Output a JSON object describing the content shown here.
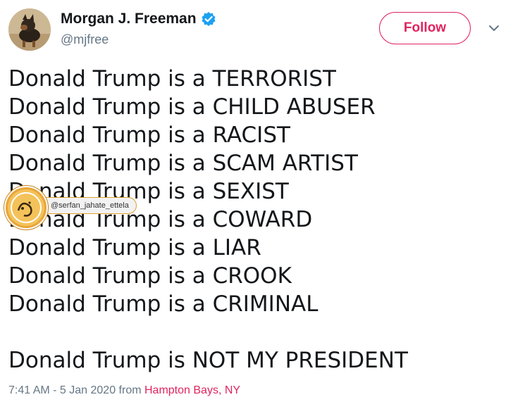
{
  "user": {
    "display_name": "Morgan J. Freeman",
    "handle": "@mjfree",
    "verified": true,
    "avatar": "dog-photo-avatar"
  },
  "follow_button": {
    "label": "Follow"
  },
  "menu": {
    "icon": "chevron-down-icon"
  },
  "tweet": {
    "lines": [
      "Donald Trump is a TERRORIST",
      "Donald Trump is a CHILD ABUSER",
      "Donald Trump is a RACIST",
      "Donald Trump is a SCAM ARTIST",
      "Donald Trump is a SEXIST",
      "Donald Trump is a COWARD",
      "Donald Trump is a LIAR",
      "Donald Trump is a CROOK",
      "Donald Trump is a CRIMINAL",
      "",
      "Donald Trump is NOT MY PRESIDENT"
    ]
  },
  "meta": {
    "time": "7:41 AM",
    "separator": " - ",
    "date": "5 Jan 2020",
    "from_label": " from ",
    "location": "Hampton Bays, NY"
  },
  "watermark": {
    "tag": "@serfan_jahate_ettela"
  },
  "colors": {
    "accent": "#e0245e",
    "verified_blue": "#1da1f2",
    "secondary_text": "#657786",
    "primary_text": "#14171a"
  }
}
